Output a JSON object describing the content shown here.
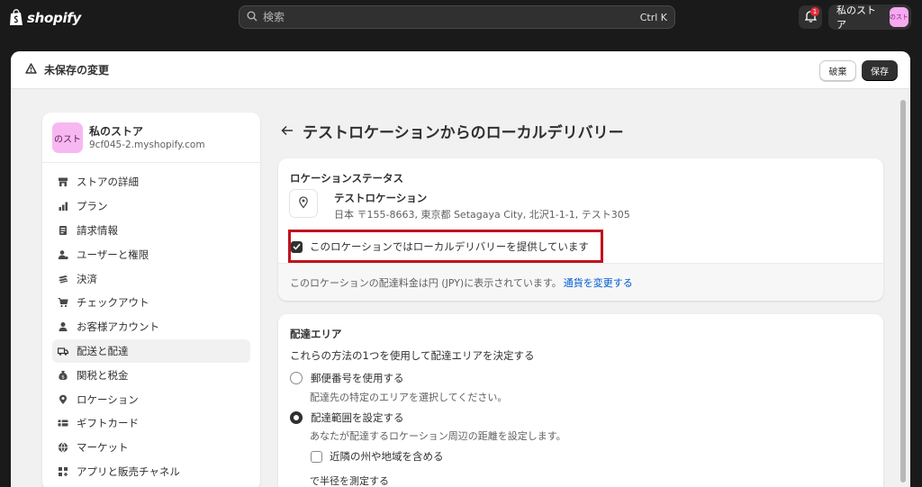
{
  "topbar": {
    "logo_text": "shopify",
    "search_placeholder": "検索",
    "search_shortcut": "Ctrl K",
    "notification_count": "1",
    "store_name": "私のストア",
    "store_avatar_text": "のスト"
  },
  "save_bar": {
    "title": "未保存の変更",
    "discard_label": "破棄",
    "save_label": "保存"
  },
  "sidebar": {
    "store_avatar_text": "のスト",
    "store_name": "私のストア",
    "store_domain": "9cf045-2.myshopify.com",
    "items": [
      {
        "label": "ストアの詳細",
        "icon": "store-icon"
      },
      {
        "label": "プラン",
        "icon": "plan-icon"
      },
      {
        "label": "請求情報",
        "icon": "billing-icon"
      },
      {
        "label": "ユーザーと権限",
        "icon": "users-icon"
      },
      {
        "label": "決済",
        "icon": "payments-icon"
      },
      {
        "label": "チェックアウト",
        "icon": "cart-icon"
      },
      {
        "label": "お客様アカウント",
        "icon": "person-icon"
      },
      {
        "label": "配送と配達",
        "icon": "truck-icon"
      },
      {
        "label": "関税と税金",
        "icon": "tax-icon"
      },
      {
        "label": "ロケーション",
        "icon": "location-icon"
      },
      {
        "label": "ギフトカード",
        "icon": "gift-card-icon"
      },
      {
        "label": "マーケット",
        "icon": "globe-icon"
      },
      {
        "label": "アプリと販売チャネル",
        "icon": "apps-icon"
      }
    ],
    "active_index": 7
  },
  "page": {
    "title": "テストロケーションからのローカルデリバリー"
  },
  "location_status": {
    "title": "ロケーションステータス",
    "location_name": "テストロケーション",
    "location_address": "日本 〒155-8663, 東京都 Setagaya City, 北沢1-1-1, テスト305",
    "checkbox_label": "このロケーションではローカルデリバリーを提供しています",
    "checkbox_checked": true,
    "footer_text": "このロケーションの配達料金は円 (JPY)に表示されています。",
    "footer_link": "通貨を変更する"
  },
  "delivery_area": {
    "title": "配達エリア",
    "description": "これらの方法の1つを使用して配達エリアを決定する",
    "option1_label": "郵便番号を使用する",
    "option1_help": "配達先の特定のエリアを選択してください。",
    "option2_label": "配達範囲を設定する",
    "option2_help": "あなたが配達するロケーション周辺の距離を設定します。",
    "selected_option": 2,
    "nearby_checkbox_label": "近隣の州や地域を含める",
    "nearby_checked": false,
    "cut_text": "で半径を測定する"
  }
}
